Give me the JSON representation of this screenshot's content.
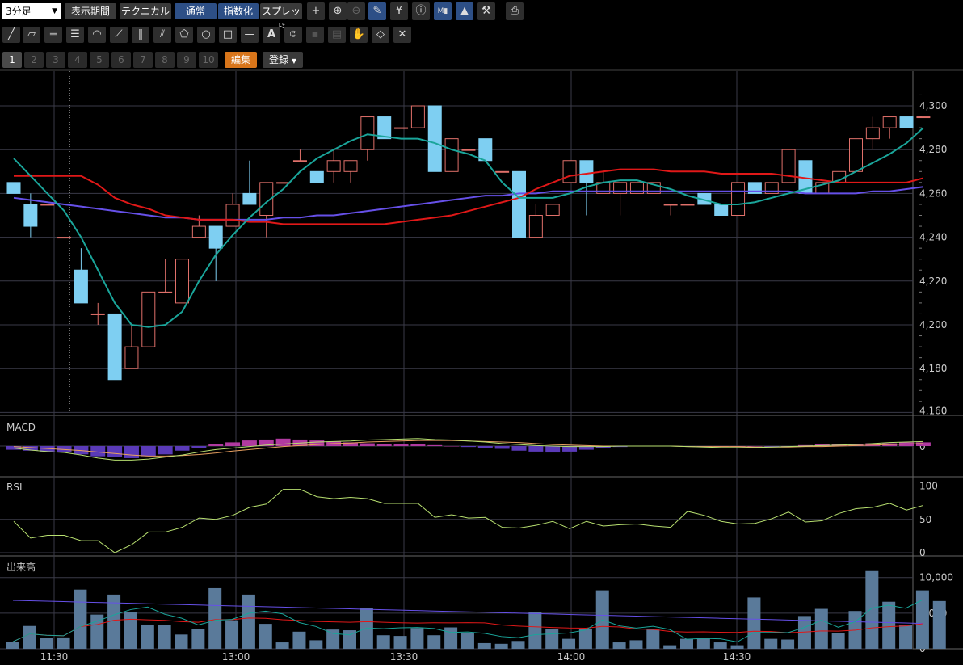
{
  "toolbar": {
    "interval": "3分足",
    "buttons": [
      "表示期間",
      "テクニカル",
      "通常",
      "指数化",
      "スプレッド"
    ],
    "tabs": [
      "1",
      "2",
      "3",
      "4",
      "5",
      "6",
      "7",
      "8",
      "9",
      "10"
    ],
    "edit_label": "編集",
    "register_label": "登録",
    "icons_row1": [
      "crosshair-icon",
      "zoom-in-icon",
      "zoom-out-icon",
      "pen-icon",
      "yen-icon",
      "info-icon",
      "my-chart-icon",
      "area-chart-icon",
      "wrench-icon",
      "print-icon"
    ],
    "icons_row2": [
      "trendline-icon",
      "ruler-icon",
      "lines-icon",
      "grid-lines-icon",
      "fan-arc-icon",
      "fan-lines-icon",
      "vertical-lines-icon",
      "channel-icon",
      "pentagon-icon",
      "circle-icon",
      "rectangle-icon",
      "horizontal-line-icon",
      "text-icon",
      "stamp-icon",
      "copy-icon",
      "layers-icon",
      "hand-icon",
      "eraser-icon",
      "clear-icon"
    ]
  },
  "panels": {
    "macd_label": "MACD",
    "rsi_label": "RSI",
    "volume_label": "出来高"
  },
  "colors": {
    "up_candle": "#000000",
    "up_border": "#e0706a",
    "down_candle": "#7ecff2",
    "sma_short": "#1aa59a",
    "sma_mid": "#e01818",
    "sma_long": "#6650e8",
    "macd_line": "#b8e070",
    "signal_line": "#e8a060",
    "hist_pos": "#b03aa0",
    "hist_neg": "#5a3ab8",
    "rsi_line": "#b8e070",
    "volume_bar": "#5a7a9a"
  },
  "chart_data": [
    {
      "type": "candlestick",
      "x_tick_labels": [
        "11:30",
        "13:00",
        "13:30",
        "14:00",
        "14:30"
      ],
      "y_tick_labels": [
        "4,300",
        "4,280",
        "4,260",
        "4,240",
        "4,220",
        "4,200",
        "4,180",
        "4,160"
      ],
      "ylim": [
        4160,
        4310
      ],
      "candles": [
        [
          4265,
          4265,
          4260,
          4260
        ],
        [
          4255,
          4260,
          4240,
          4245
        ],
        [
          4255,
          4255,
          4255,
          4255
        ],
        [
          4240,
          4240,
          4240,
          4240
        ],
        [
          4225,
          4235,
          4210,
          4210
        ],
        [
          4205,
          4210,
          4200,
          4205
        ],
        [
          4205,
          4205,
          4175,
          4175
        ],
        [
          4180,
          4200,
          4180,
          4190
        ],
        [
          4190,
          4215,
          4190,
          4215
        ],
        [
          4215,
          4230,
          4215,
          4215
        ],
        [
          4210,
          4230,
          4210,
          4230
        ],
        [
          4240,
          4250,
          4240,
          4245
        ],
        [
          4245,
          4245,
          4220,
          4235
        ],
        [
          4245,
          4260,
          4245,
          4255
        ],
        [
          4260,
          4275,
          4255,
          4255
        ],
        [
          4250,
          4265,
          4240,
          4265
        ],
        [
          4265,
          4265,
          4265,
          4265
        ],
        [
          4275,
          4280,
          4275,
          4275
        ],
        [
          4270,
          4270,
          4265,
          4265
        ],
        [
          4270,
          4280,
          4265,
          4275
        ],
        [
          4270,
          4270,
          4265,
          4275
        ],
        [
          4280,
          4295,
          4275,
          4295
        ],
        [
          4295,
          4295,
          4285,
          4285
        ],
        [
          4290,
          4290,
          4290,
          4290
        ],
        [
          4290,
          4300,
          4290,
          4300
        ],
        [
          4300,
          4300,
          4270,
          4270
        ],
        [
          4270,
          4285,
          4270,
          4285
        ],
        [
          4280,
          4280,
          4280,
          4280
        ],
        [
          4285,
          4285,
          4275,
          4275
        ],
        [
          4270,
          4270,
          4270,
          4270
        ],
        [
          4270,
          4270,
          4240,
          4240
        ],
        [
          4240,
          4255,
          4240,
          4250
        ],
        [
          4250,
          4255,
          4250,
          4255
        ],
        [
          4265,
          4275,
          4265,
          4275
        ],
        [
          4275,
          4275,
          4250,
          4265
        ],
        [
          4260,
          4270,
          4260,
          4265
        ],
        [
          4260,
          4265,
          4250,
          4265
        ],
        [
          4260,
          4265,
          4260,
          4265
        ],
        [
          4260,
          4265,
          4260,
          4265
        ],
        [
          4255,
          4255,
          4250,
          4255
        ],
        [
          4255,
          4255,
          4255,
          4255
        ],
        [
          4260,
          4260,
          4255,
          4255
        ],
        [
          4255,
          4255,
          4250,
          4250
        ],
        [
          4250,
          4270,
          4240,
          4265
        ],
        [
          4265,
          4265,
          4260,
          4260
        ],
        [
          4260,
          4265,
          4260,
          4265
        ],
        [
          4265,
          4280,
          4265,
          4280
        ],
        [
          4275,
          4275,
          4260,
          4260
        ],
        [
          4260,
          4265,
          4260,
          4265
        ],
        [
          4265,
          4270,
          4265,
          4270
        ],
        [
          4270,
          4285,
          4270,
          4285
        ],
        [
          4285,
          4295,
          4280,
          4290
        ],
        [
          4290,
          4295,
          4285,
          4295
        ],
        [
          4295,
          4295,
          4290,
          4290
        ],
        [
          4295,
          4295,
          4295,
          4295
        ]
      ],
      "sma_short": [
        4276,
        4268,
        4260,
        4252,
        4240,
        4225,
        4210,
        4200,
        4199,
        4200,
        4206,
        4220,
        4232,
        4241,
        4249,
        4256,
        4262,
        4270,
        4276,
        4280,
        4284,
        4287,
        4286,
        4285,
        4285,
        4283,
        4280,
        4278,
        4275,
        4265,
        4258,
        4258,
        4258,
        4260,
        4263,
        4265,
        4266,
        4266,
        4264,
        4262,
        4259,
        4257,
        4255,
        4255,
        4256,
        4258,
        4260,
        4262,
        4264,
        4266,
        4270,
        4274,
        4278,
        4283,
        4290
      ],
      "sma_mid": [
        4268,
        4268,
        4268,
        4268,
        4268,
        4264,
        4258,
        4255,
        4253,
        4250,
        4249,
        4248,
        4248,
        4248,
        4247,
        4247,
        4246,
        4246,
        4246,
        4246,
        4246,
        4246,
        4246,
        4247,
        4248,
        4249,
        4250,
        4252,
        4254,
        4256,
        4258,
        4262,
        4265,
        4268,
        4269,
        4270,
        4271,
        4271,
        4271,
        4270,
        4270,
        4270,
        4269,
        4269,
        4269,
        4269,
        4268,
        4267,
        4266,
        4265,
        4265,
        4265,
        4265,
        4265,
        4267
      ],
      "sma_long": [
        4258,
        4257,
        4256,
        4255,
        4254,
        4253,
        4252,
        4251,
        4250,
        4249,
        4249,
        4248,
        4248,
        4248,
        4248,
        4248,
        4249,
        4249,
        4250,
        4250,
        4251,
        4252,
        4253,
        4254,
        4255,
        4256,
        4257,
        4258,
        4259,
        4259,
        4260,
        4260,
        4261,
        4261,
        4261,
        4261,
        4261,
        4261,
        4261,
        4261,
        4261,
        4261,
        4261,
        4261,
        4261,
        4261,
        4261,
        4260,
        4260,
        4260,
        4260,
        4261,
        4261,
        4262,
        4263
      ],
      "volume": [
        1000,
        3200,
        1500,
        1600,
        8300,
        4800,
        7600,
        5200,
        3400,
        3300,
        2000,
        2800,
        8500,
        4000,
        7600,
        3500,
        900,
        2400,
        1200,
        2700,
        2600,
        5700,
        1900,
        1800,
        2900,
        1900,
        3000,
        2200,
        800,
        700,
        1100,
        5100,
        2800,
        1400,
        2800,
        8200,
        900,
        1200,
        2700,
        500,
        1400,
        1500,
        900,
        500,
        7200,
        1400,
        1300,
        4600,
        5600,
        2200,
        5300,
        10900,
        6600,
        3400,
        8200,
        6700
      ],
      "volume_y_tick_labels": [
        "10,000",
        "5,000",
        "0"
      ],
      "macd_y_tick_labels": [
        "0"
      ],
      "rsi_y_tick_labels": [
        "100",
        "50",
        "0"
      ],
      "rsi": [
        47,
        22,
        26,
        26,
        18,
        18,
        0,
        12,
        31,
        31,
        38,
        52,
        50,
        56,
        68,
        73,
        95,
        95,
        84,
        81,
        83,
        81,
        74,
        74,
        74,
        53,
        57,
        52,
        53,
        38,
        37,
        41,
        47,
        36,
        47,
        40,
        42,
        43,
        40,
        38,
        62,
        56,
        47,
        43,
        44,
        51,
        61,
        46,
        48,
        59,
        66,
        68,
        74,
        64,
        71
      ],
      "macd_hist": [
        -4,
        -5,
        -6,
        -7,
        -9,
        -11,
        -12,
        -13,
        -11,
        -9,
        -5,
        -2,
        2,
        4,
        6,
        7,
        8,
        7,
        6,
        5,
        4,
        3,
        2,
        2,
        2,
        1,
        0,
        -1,
        -2,
        -3,
        -5,
        -6,
        -7,
        -6,
        -4,
        -2,
        -1,
        0,
        0,
        0,
        0,
        0,
        0,
        0,
        0,
        -1,
        0,
        1,
        2,
        2,
        2,
        3,
        3,
        4,
        4
      ],
      "macd_line": [
        -4,
        -8,
        -11,
        -13,
        -18,
        -24,
        -28,
        -28,
        -26,
        -22,
        -18,
        -12,
        -7,
        -4,
        -1,
        2,
        4,
        6,
        8,
        9,
        10,
        12,
        13,
        14,
        15,
        13,
        12,
        10,
        8,
        5,
        3,
        1,
        0,
        -1,
        -1,
        -1,
        0,
        0,
        0,
        0,
        -1,
        -2,
        -3,
        -3,
        -3,
        -2,
        -1,
        0,
        1,
        2,
        3,
        5,
        7,
        8,
        9
      ],
      "signal_line": [
        -1,
        -3,
        -5,
        -7,
        -9,
        -12,
        -15,
        -18,
        -20,
        -20,
        -19,
        -17,
        -14,
        -10,
        -7,
        -4,
        -1,
        1,
        3,
        5,
        6,
        8,
        9,
        10,
        11,
        11,
        11,
        10,
        9,
        8,
        7,
        5,
        3,
        2,
        1,
        0,
        0,
        0,
        0,
        0,
        -1,
        -1,
        -1,
        -1,
        -2,
        -2,
        -2,
        -1,
        -1,
        0,
        1,
        2,
        3,
        4,
        5
      ]
    }
  ]
}
